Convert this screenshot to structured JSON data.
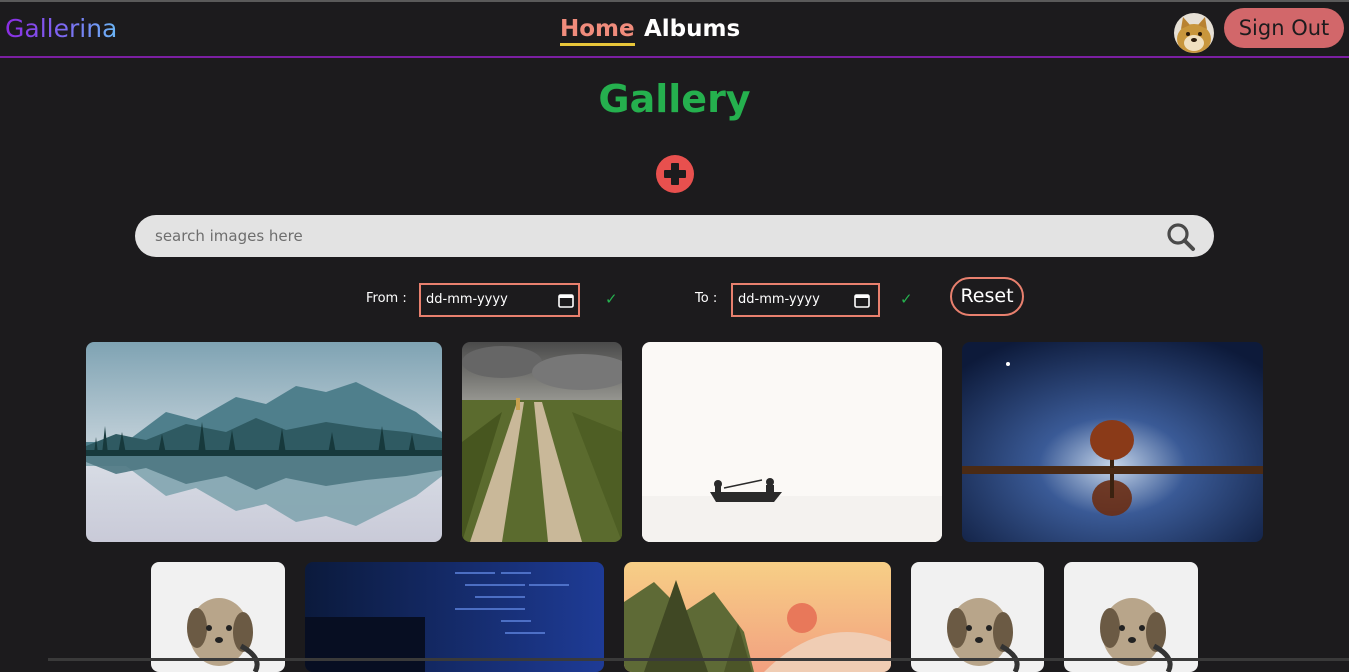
{
  "app": {
    "logo": "Gallerina"
  },
  "nav": {
    "home": "Home",
    "albums": "Albums",
    "signout": "Sign Out"
  },
  "page": {
    "title": "Gallery"
  },
  "search": {
    "placeholder": "search images here"
  },
  "filters": {
    "from_label": "From :",
    "to_label": "To :",
    "from_value": "dd-mm-yyyy",
    "to_value": "dd-mm-yyyy",
    "check": "✓",
    "reset": "Reset"
  },
  "images": [
    {
      "name": "mountain-lake-reflection-illustration"
    },
    {
      "name": "dirt-road-through-field"
    },
    {
      "name": "boat-on-white-sea"
    },
    {
      "name": "tree-reflection-night"
    },
    {
      "name": "dog-with-headphones"
    },
    {
      "name": "code-screen-blue"
    },
    {
      "name": "sunset-mountains-illustration"
    },
    {
      "name": "dog-with-headphones"
    },
    {
      "name": "dog-with-headphones"
    }
  ],
  "colors": {
    "accent": "#f08c7c",
    "title": "#25b04e",
    "signout": "#d2676a",
    "add": "#e8504e",
    "navborder": "#7b1fa2"
  }
}
